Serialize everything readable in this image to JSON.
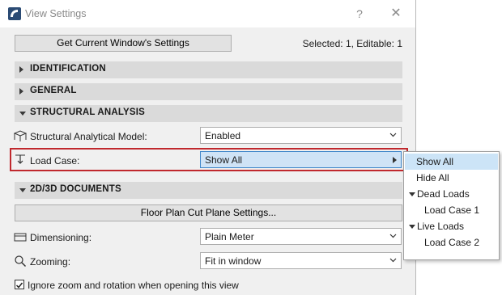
{
  "window": {
    "title": "View Settings",
    "help_label": "?",
    "close_label": "✕"
  },
  "header": {
    "get_settings_label": "Get Current Window's Settings",
    "selected_info": "Selected: 1, Editable: 1"
  },
  "sections": {
    "identification": "IDENTIFICATION",
    "general": "GENERAL",
    "structural_analysis": "STRUCTURAL ANALYSIS",
    "documents": "2D/3D DOCUMENTS"
  },
  "structural": {
    "model_label": "Structural Analytical Model:",
    "model_value": "Enabled",
    "load_case_label": "Load Case:",
    "load_case_value": "Show All"
  },
  "documents": {
    "cut_plane_button": "Floor Plan Cut Plane Settings...",
    "dimensioning_label": "Dimensioning:",
    "dimensioning_value": "Plain Meter",
    "zooming_label": "Zooming:",
    "zooming_value": "Fit in window",
    "ignore_zoom_label": "Ignore zoom and rotation when opening this view",
    "ignore_zoom_checked": true
  },
  "load_case_menu": {
    "items": [
      {
        "label": "Show All",
        "selected": true
      },
      {
        "label": "Hide All"
      },
      {
        "label": "Dead Loads",
        "group": true
      },
      {
        "label": "Load Case 1"
      },
      {
        "label": "Live Loads",
        "group": true
      },
      {
        "label": "Load Case 2"
      }
    ]
  },
  "colors": {
    "highlight_border": "#c0282d",
    "selected_item_bg": "#cce4f7",
    "section_bg": "#dadada"
  }
}
